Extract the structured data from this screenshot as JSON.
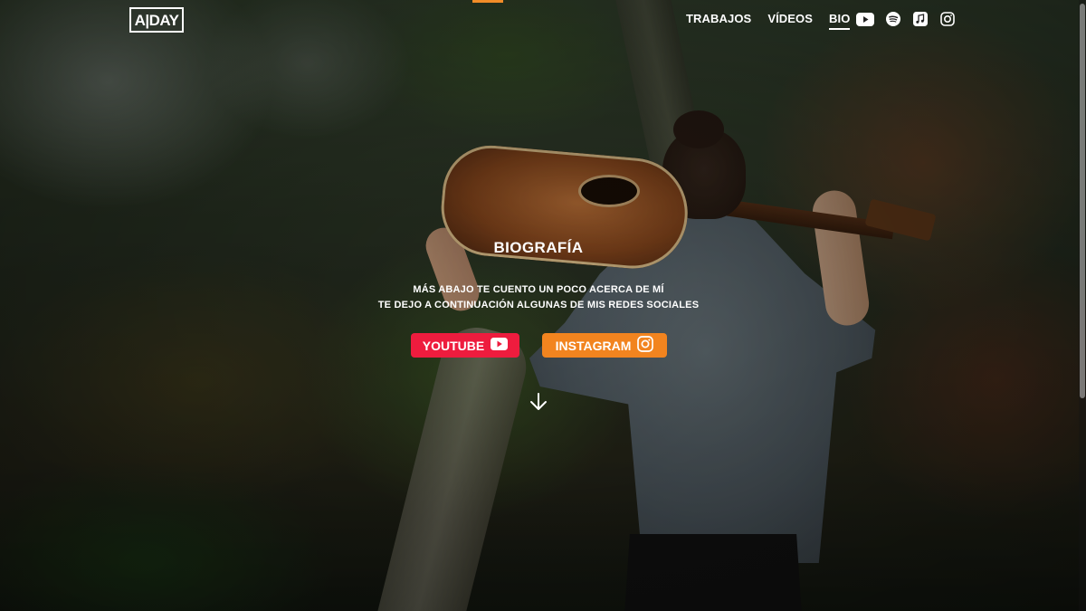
{
  "logo": {
    "text": "A|DAY"
  },
  "nav": {
    "items": [
      {
        "label": "TRABAJOS"
      },
      {
        "label": "VÍDEOS"
      },
      {
        "label": "BIO",
        "active": true
      }
    ]
  },
  "socials": [
    "youtube-icon",
    "spotify-icon",
    "music-icon",
    "instagram-icon"
  ],
  "hero": {
    "title": "BIOGRAFÍA",
    "line1": "MÁS ABAJO TE CUENTO UN POCO ACERCA DE MÍ",
    "line2": "TE DEJO A CONTINUACIÓN ALGUNAS DE MIS REDES SOCIALES"
  },
  "buttons": {
    "youtube": {
      "label": "YOUTUBE",
      "icon": "youtube-icon",
      "color": "#ee1c3e"
    },
    "instagram": {
      "label": "INSTAGRAM",
      "icon": "instagram-icon",
      "color": "#f2841f"
    }
  },
  "colors": {
    "accent": "#f28c28",
    "youtube": "#ee1c3e",
    "instagram": "#f2841f"
  }
}
